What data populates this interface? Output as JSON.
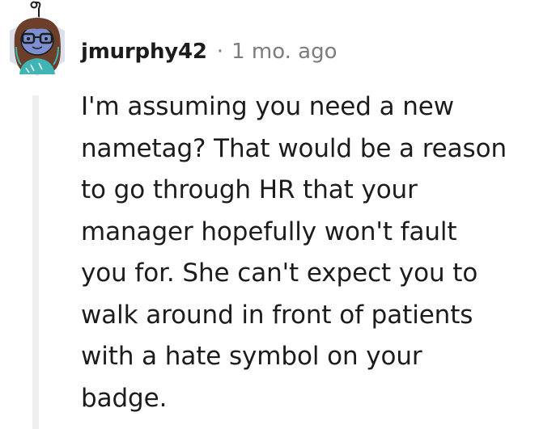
{
  "comment": {
    "username": "jmurphy42",
    "separator": "·",
    "timestamp": "1 mo. ago",
    "body_lines": [
      "I'm assuming you need a new",
      "nametag? That would be a reason",
      "to go through HR that your",
      "manager hopefully won't fault",
      "you for. She can't expect you to",
      "walk around in front of patients",
      "with a hate symbol on your",
      "badge."
    ]
  },
  "colors": {
    "text": "#1c1c1c",
    "meta": "#7c7c7c",
    "thread_line": "#edeff1",
    "avatar_skin": "#7b8fd1",
    "avatar_hair": "#6b3f2a",
    "avatar_shirt": "#3fb5b5"
  },
  "icons": {
    "avatar": "snoo-avatar-icon"
  }
}
